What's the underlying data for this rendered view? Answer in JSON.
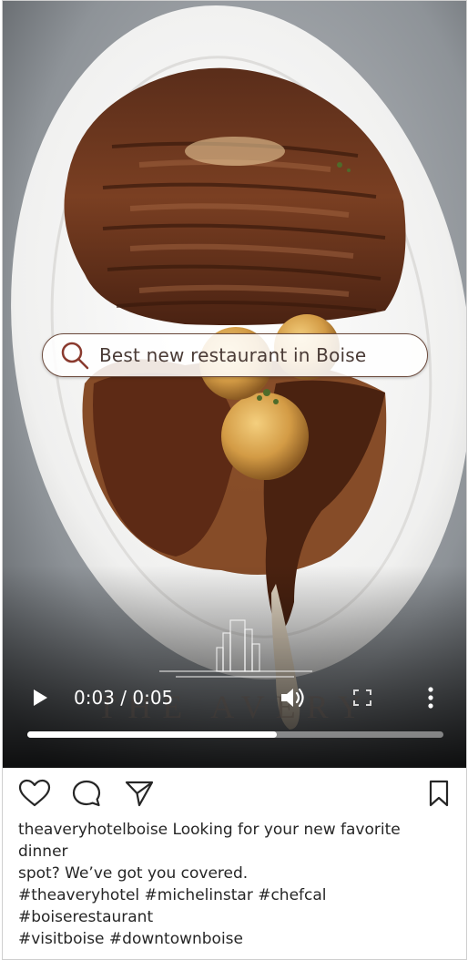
{
  "search": {
    "query": "Best new restaurant in Boise"
  },
  "brand": {
    "wordmark": "THE AVERY"
  },
  "player": {
    "time_display": "0:03 / 0:05",
    "progress_fraction": 0.6,
    "icons": [
      "play-icon",
      "volume-icon",
      "fullscreen-icon",
      "more-options-icon"
    ]
  },
  "actions": {
    "icons": [
      "heart-icon",
      "comment-icon",
      "share-icon",
      "bookmark-icon"
    ]
  },
  "caption": {
    "lines": [
      "theaveryhotelboise Looking for your new favorite",
      "dinner",
      "spot? We’ve got you covered.",
      "#theaveryhotel #michelinstar #chefcal",
      "#boiserestaurant",
      "#visitboise #downtownboise"
    ]
  },
  "colors": {
    "search_border": "#6b4a3c",
    "search_icon": "#8a3a2e",
    "caption_text": "#262626"
  }
}
